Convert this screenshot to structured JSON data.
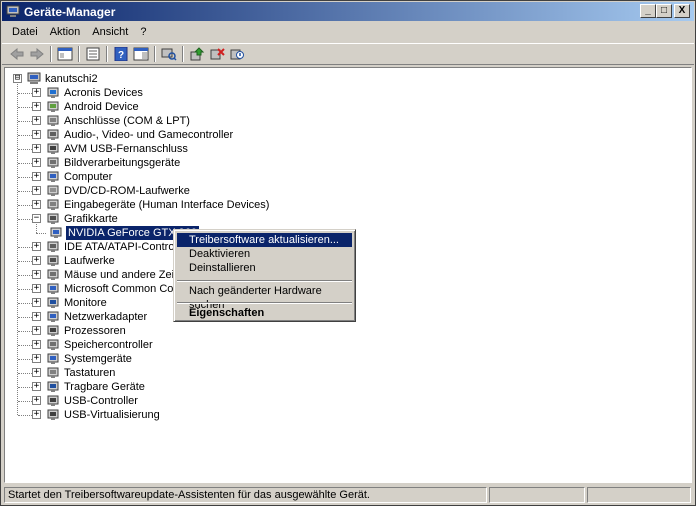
{
  "window": {
    "title": "Geräte-Manager",
    "minimize_glyph": "_",
    "maximize_glyph": "□",
    "close_glyph": "X"
  },
  "menubar": {
    "items": [
      {
        "label": "Datei"
      },
      {
        "label": "Aktion"
      },
      {
        "label": "Ansicht"
      },
      {
        "label": "?"
      }
    ]
  },
  "toolbar": {
    "buttons": [
      "back-icon",
      "forward-icon",
      "console-tree-icon",
      "properties-icon",
      "help-icon",
      "action-pane-icon",
      "scan-hardware-icon",
      "update-driver-icon",
      "uninstall-icon",
      "disable-icon"
    ]
  },
  "tree": {
    "root": {
      "label": "kanutschi2",
      "expander": "⊟"
    },
    "items": [
      {
        "label": "Acronis Devices",
        "icon": "acronis-icon",
        "expander": "+"
      },
      {
        "label": "Android Device",
        "icon": "android-icon",
        "expander": "+"
      },
      {
        "label": "Anschlüsse (COM & LPT)",
        "icon": "port-icon",
        "expander": "+"
      },
      {
        "label": "Audio-, Video- und Gamecontroller",
        "icon": "speaker-icon",
        "expander": "+"
      },
      {
        "label": "AVM USB-Fernanschluss",
        "icon": "usb-icon",
        "expander": "+"
      },
      {
        "label": "Bildverarbeitungsgeräte",
        "icon": "scanner-icon",
        "expander": "+"
      },
      {
        "label": "Computer",
        "icon": "computer-icon",
        "expander": "+"
      },
      {
        "label": "DVD/CD-ROM-Laufwerke",
        "icon": "dvd-icon",
        "expander": "+"
      },
      {
        "label": "Eingabegeräte (Human Interface Devices)",
        "icon": "hid-icon",
        "expander": "+"
      },
      {
        "label": "Grafikkarte",
        "icon": "display-adapter-icon",
        "expander": "−"
      },
      {
        "label": "NVIDIA GeForce GTX 960",
        "icon": "gpu-icon",
        "expander": "",
        "selected": true,
        "child": true
      },
      {
        "label": "IDE ATA/ATAPI-Controller",
        "icon": "ide-icon",
        "expander": "+"
      },
      {
        "label": "Laufwerke",
        "icon": "drive-icon",
        "expander": "+"
      },
      {
        "label": "Mäuse und andere Zeigegeräte",
        "icon": "mouse-icon",
        "expander": "+"
      },
      {
        "label": "Microsoft Common Controller",
        "icon": "controller-icon",
        "expander": "+"
      },
      {
        "label": "Monitore",
        "icon": "monitor-icon",
        "expander": "+"
      },
      {
        "label": "Netzwerkadapter",
        "icon": "network-icon",
        "expander": "+"
      },
      {
        "label": "Prozessoren",
        "icon": "processor-icon",
        "expander": "+"
      },
      {
        "label": "Speichercontroller",
        "icon": "storage-icon",
        "expander": "+"
      },
      {
        "label": "Systemgeräte",
        "icon": "system-icon",
        "expander": "+"
      },
      {
        "label": "Tastaturen",
        "icon": "keyboard-icon",
        "expander": "+"
      },
      {
        "label": "Tragbare Geräte",
        "icon": "portable-icon",
        "expander": "+"
      },
      {
        "label": "USB-Controller",
        "icon": "usb-icon",
        "expander": "+"
      },
      {
        "label": "USB-Virtualisierung",
        "icon": "usb-icon",
        "expander": "+"
      }
    ]
  },
  "context_menu": {
    "update_driver": "Treibersoftware aktualisieren...",
    "disable": "Deaktivieren",
    "uninstall": "Deinstallieren",
    "scan_hardware": "Nach geänderter Hardware suchen",
    "properties": "Eigenschaften"
  },
  "statusbar": {
    "text": "Startet den Treibersoftwareupdate-Assistenten für das ausgewählte Gerät."
  },
  "colors": {
    "selection": "#0a246a",
    "title_gradient_start": "#0a246a",
    "title_gradient_end": "#a6caf0",
    "window_face": "#d4d0c8"
  }
}
